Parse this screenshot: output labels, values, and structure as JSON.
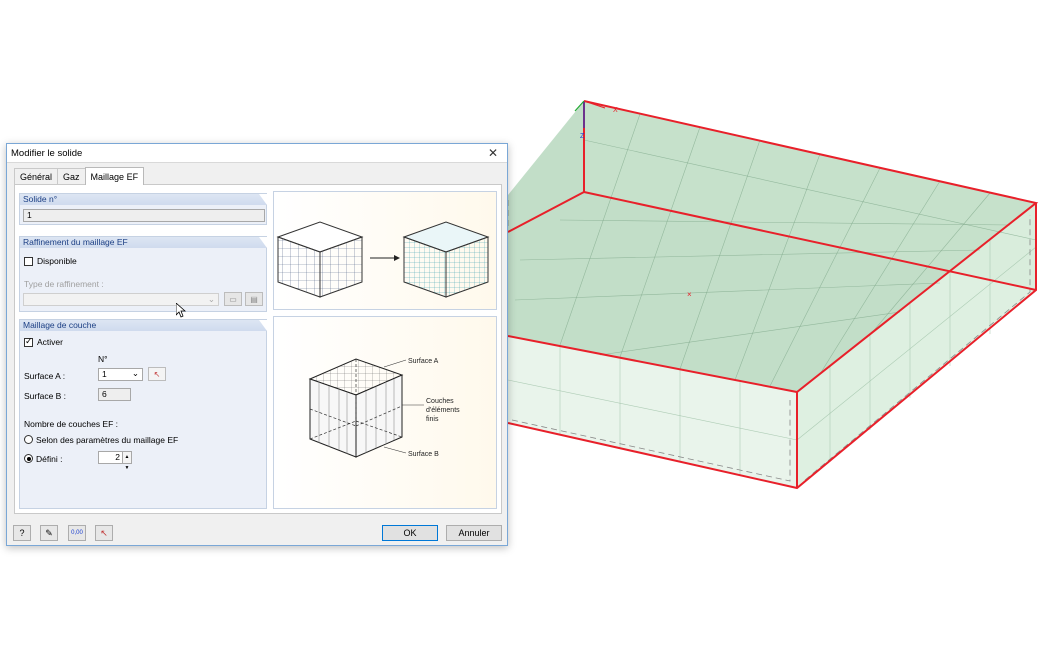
{
  "dialog": {
    "title": "Modifier le solide",
    "tabs": [
      "Général",
      "Gaz",
      "Maillage EF"
    ],
    "solid_group": {
      "header": "Solide n°",
      "value": "1"
    },
    "refinement_group": {
      "header": "Raffinement du maillage EF",
      "available_label": "Disponible",
      "available_checked": false,
      "type_label": "Type de raffinement :"
    },
    "layer_group": {
      "header": "Maillage de couche",
      "activate_label": "Activer",
      "activate_checked": true,
      "number_header": "N°",
      "surface_a_label": "Surface A :",
      "surface_a_value": "1",
      "surface_b_label": "Surface B :",
      "surface_b_value": "6",
      "layers_label": "Nombre de couches EF :",
      "option_mesh_params": "Selon des paramètres du maillage EF",
      "option_defined": "Défini :",
      "defined_value": "2",
      "selected_option": "defined"
    },
    "illustration": {
      "surface_a": "Surface A",
      "layers_line1": "Couches",
      "layers_line2": "d'éléments",
      "layers_line3": "finis",
      "surface_b": "Surface B"
    },
    "buttons": {
      "ok": "OK",
      "cancel": "Annuler",
      "units_icon_text": "0,00"
    }
  },
  "viewport": {
    "axis_x": "X",
    "axis_z": "Z"
  },
  "colors": {
    "edge_red": "#e8202a",
    "solid_fill": "#8fc39b",
    "group_header_text": "#1c3f84",
    "ok_border": "#0078d7"
  }
}
